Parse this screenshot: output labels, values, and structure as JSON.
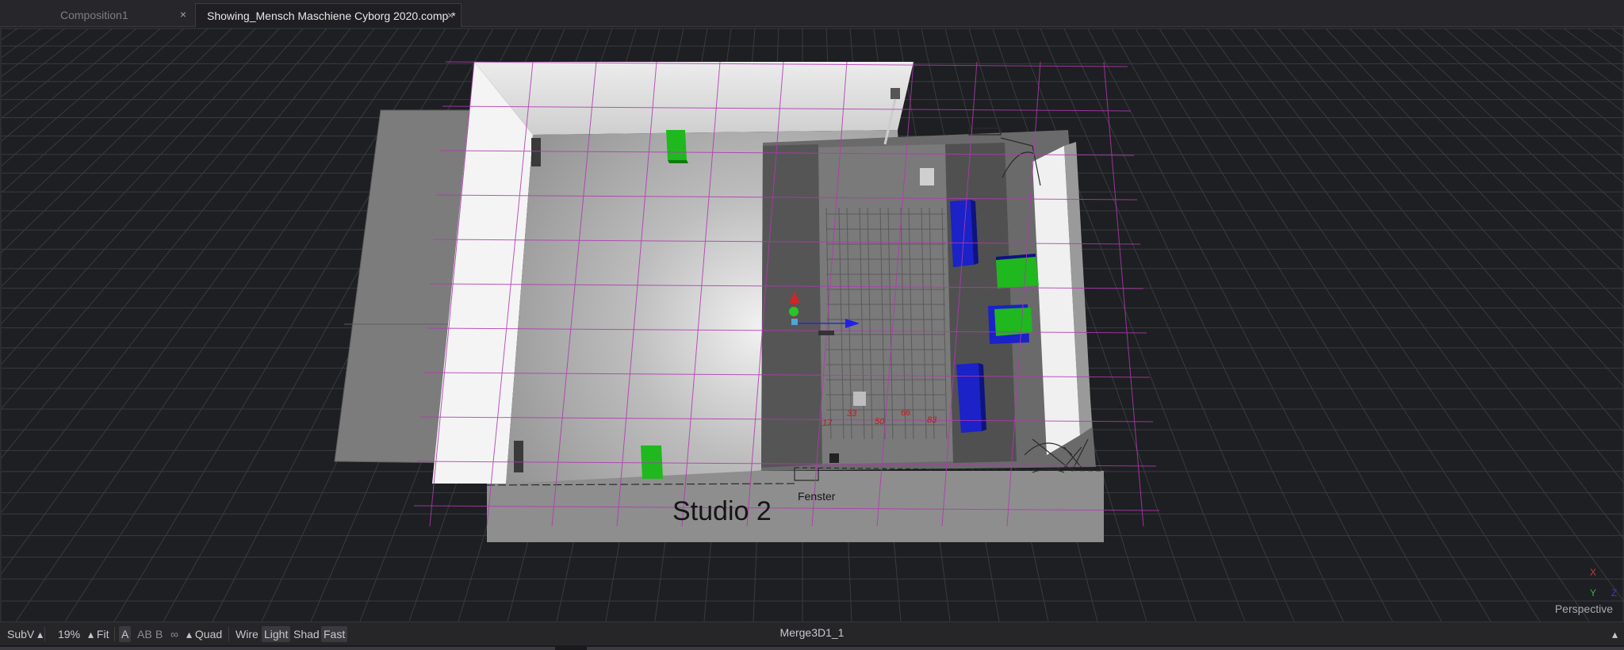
{
  "tabs": [
    {
      "label": "Composition1"
    },
    {
      "label": "Showing_Mensch Maschiene Cyborg 2020.comp *"
    }
  ],
  "scene": {
    "studio_label": "Studio 2",
    "window_label": "Fenster",
    "seat_numbers": [
      "17",
      "33",
      "50",
      "66",
      "83"
    ],
    "axis_x": "X",
    "axis_y": "Y",
    "axis_z": "Z",
    "view_mode": "Perspective"
  },
  "toolbar": {
    "subv": "SubV",
    "zoom": "19%",
    "fit": "Fit",
    "channel_a": "A",
    "channel_ab": "AB",
    "channel_b": "B",
    "quad": "Quad",
    "wire": "Wire",
    "light": "Light",
    "shad": "Shad",
    "fast": "Fast",
    "node_name": "Merge3D1_1"
  },
  "colors": {
    "accent_magenta": "#b03ab0",
    "blue_box": "#1a22c8",
    "green_box": "#1fb81f"
  }
}
